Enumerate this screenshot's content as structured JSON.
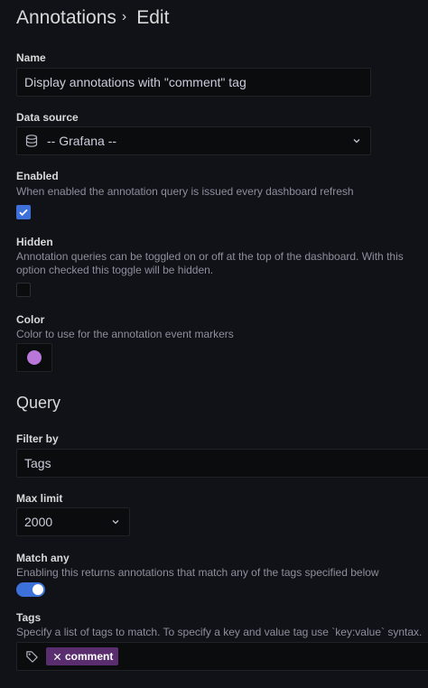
{
  "breadcrumb": {
    "parent": "Annotations",
    "separator": "›",
    "current": "Edit"
  },
  "name": {
    "label": "Name",
    "value": "Display annotations with \"comment\" tag"
  },
  "data_source": {
    "label": "Data source",
    "value": "-- Grafana --",
    "icon": "database-icon"
  },
  "enabled": {
    "label": "Enabled",
    "description": "When enabled the annotation query is issued every dashboard refresh",
    "checked": true
  },
  "hidden": {
    "label": "Hidden",
    "description": "Annotation queries can be toggled on or off at the top of the dashboard. With this option checked this toggle will be hidden.",
    "checked": false
  },
  "color": {
    "label": "Color",
    "description": "Color to use for the annotation event markers",
    "value": "#b877d9"
  },
  "query": {
    "title": "Query",
    "filter_by": {
      "label": "Filter by",
      "value": "Tags"
    },
    "max_limit": {
      "label": "Max limit",
      "value": "2000"
    },
    "match_any": {
      "label": "Match any",
      "description": "Enabling this returns annotations that match any of the tags specified below",
      "on": true
    },
    "tags": {
      "label": "Tags",
      "description": "Specify a list of tags to match. To specify a key and value tag use `key:value` syntax.",
      "items": [
        {
          "label": "comment",
          "color": "#5a2d6e"
        }
      ]
    }
  },
  "colors": {
    "accent": "#3d71d9",
    "background": "#111217",
    "input_bg": "#0b0c0e"
  }
}
